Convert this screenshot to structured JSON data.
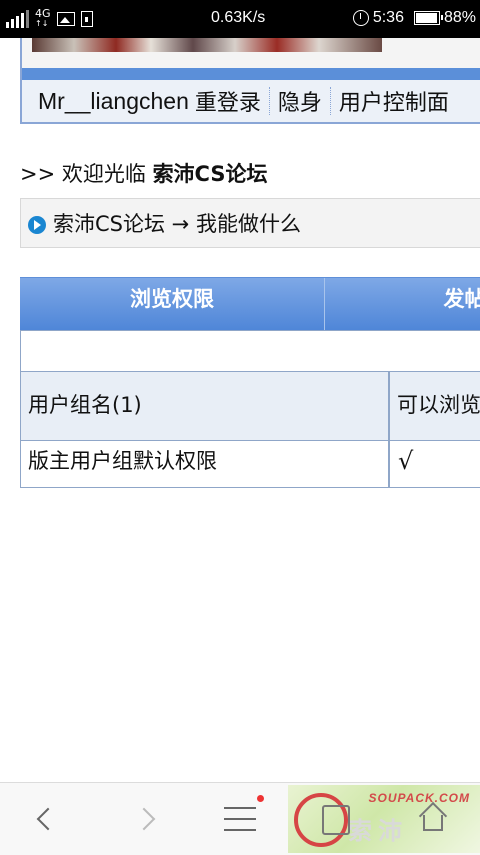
{
  "status_bar": {
    "network": "4G",
    "network_sub": "↑↓",
    "speed": "0.63K/s",
    "time": "5:36",
    "battery": "88%"
  },
  "userbar": {
    "username": "Mr__liangchen",
    "relogin": "重登录",
    "invisible": "隐身",
    "control_panel": "用户控制面"
  },
  "welcome": {
    "prefix": ">> 欢迎光临",
    "forum_name": "索沛CS论坛"
  },
  "breadcrumb": {
    "text": "索沛CS论坛 → 我能做什么"
  },
  "permissions_table": {
    "headers": [
      "浏览权限",
      "发帖权"
    ],
    "group_header": [
      "用户组名(1)",
      "可以浏览"
    ],
    "rows": [
      {
        "group": "版主用户组默认权限",
        "can_browse": "√"
      }
    ]
  },
  "watermark": {
    "site": "SOUPACK.COM",
    "name": "索沛"
  }
}
